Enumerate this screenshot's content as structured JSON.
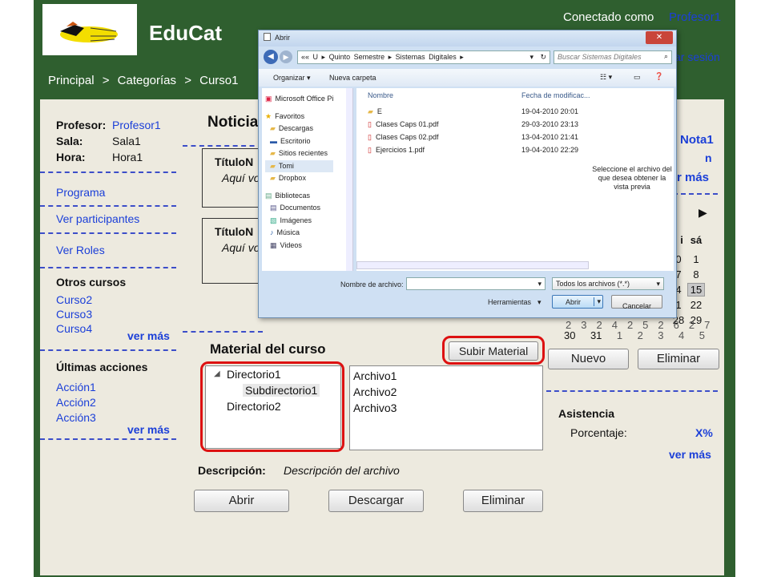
{
  "header": {
    "brand": "EduCat",
    "connected_label": "Conectado como",
    "user": "Profesor1",
    "logout": "ar sesión"
  },
  "breadcrumb": {
    "items": [
      "Principal",
      ">",
      "Categorías",
      ">",
      "Curso1"
    ]
  },
  "left": {
    "profesor_label": "Profesor:",
    "profesor": "Profesor1",
    "sala_label": "Sala:",
    "sala": "Sala1",
    "hora_label": "Hora:",
    "hora": "Hora1",
    "links": [
      "Programa",
      "Ver participantes",
      "Ver Roles"
    ],
    "otros_title": "Otros cursos",
    "otros": [
      "Curso2",
      "Curso3",
      "Curso4"
    ],
    "otros_more": "ver más",
    "ultimas_title": "Últimas acciones",
    "ultimas": [
      "Acción1",
      "Acción2",
      "Acción3"
    ],
    "ultimas_more": "ver más"
  },
  "news": {
    "title": "Noticia",
    "items": [
      {
        "title": "TítuloN",
        "body": "Aquí vo"
      },
      {
        "title": "TítuloN",
        "body": "Aquí vo"
      }
    ]
  },
  "material": {
    "title": "Material del curso",
    "upload": "Subir Material",
    "tree": [
      "Directorio1",
      "Subdirectorio1",
      "Directorio2"
    ],
    "files": [
      "Archivo1",
      "Archivo2",
      "Archivo3"
    ],
    "desc_label": "Descripción:",
    "desc": "Descripción del archivo",
    "buttons": [
      "Abrir",
      "Descargar",
      "Eliminar"
    ]
  },
  "right": {
    "nota": "Nota1",
    "n": "n",
    "vermas": "r más",
    "cal_next": "▶",
    "cal_head": [
      "i",
      "sá"
    ],
    "cal_rows": [
      [
        "0",
        "1"
      ],
      [
        "7",
        "8"
      ],
      [
        "4",
        "15"
      ],
      [
        "1",
        "22"
      ],
      [
        "28",
        "29"
      ]
    ],
    "cal_last": [
      "30",
      "31",
      "1",
      "2",
      "3",
      "4",
      "5"
    ],
    "cal_partial": [
      "23",
      "24",
      "25",
      "26",
      "27"
    ],
    "nuevo": "Nuevo",
    "eliminar": "Eliminar",
    "asist_title": "Asistencia",
    "porc_label": "Porcentaje:",
    "porc": "X%",
    "asist_more": "ver más"
  },
  "dialog": {
    "title": "Abrir",
    "close": "✕",
    "path": [
      "«« U",
      "▸",
      "Quinto Semestre",
      "▸",
      "Sistemas Digitales",
      "▸"
    ],
    "search": "Buscar Sistemas Digitales",
    "organize": "Organizar ▾",
    "new_folder": "Nueva carpeta",
    "nav": [
      {
        "label": "Microsoft Office Pi",
        "icon": "office-icon"
      },
      {
        "label": "Favoritos",
        "icon": "star-icon"
      },
      {
        "label": "Descargas",
        "icon": "folder-icon"
      },
      {
        "label": "Escritorio",
        "icon": "desktop-icon"
      },
      {
        "label": "Sitios recientes",
        "icon": "folder-icon"
      },
      {
        "label": "Tomi",
        "icon": "folder-icon"
      },
      {
        "label": "Dropbox",
        "icon": "folder-icon"
      },
      {
        "label": "Bibliotecas",
        "icon": "library-icon"
      },
      {
        "label": "Documentos",
        "icon": "doc-icon"
      },
      {
        "label": "Imágenes",
        "icon": "image-icon"
      },
      {
        "label": "Música",
        "icon": "music-icon"
      },
      {
        "label": "Videos",
        "icon": "video-icon"
      }
    ],
    "col_name": "Nombre",
    "col_date": "Fecha de modificac...",
    "files": [
      {
        "name": "E",
        "date": "19-04-2010 20:01",
        "icon": "folder-icon"
      },
      {
        "name": "Clases Caps 01.pdf",
        "date": "29-03-2010 23:13",
        "icon": "pdf-icon"
      },
      {
        "name": "Clases Caps 02.pdf",
        "date": "13-04-2010 21:41",
        "icon": "pdf-icon"
      },
      {
        "name": "Ejercicios 1.pdf",
        "date": "19-04-2010 22:29",
        "icon": "pdf-icon"
      }
    ],
    "preview": "Seleccione el archivo del que desea obtener la vista previa",
    "filename_label": "Nombre de archivo:",
    "filename": "",
    "filter": "Todos los archivos (*.*)",
    "tools": "Herramientas",
    "open": "Abrir",
    "cancel": "Cancelar"
  }
}
